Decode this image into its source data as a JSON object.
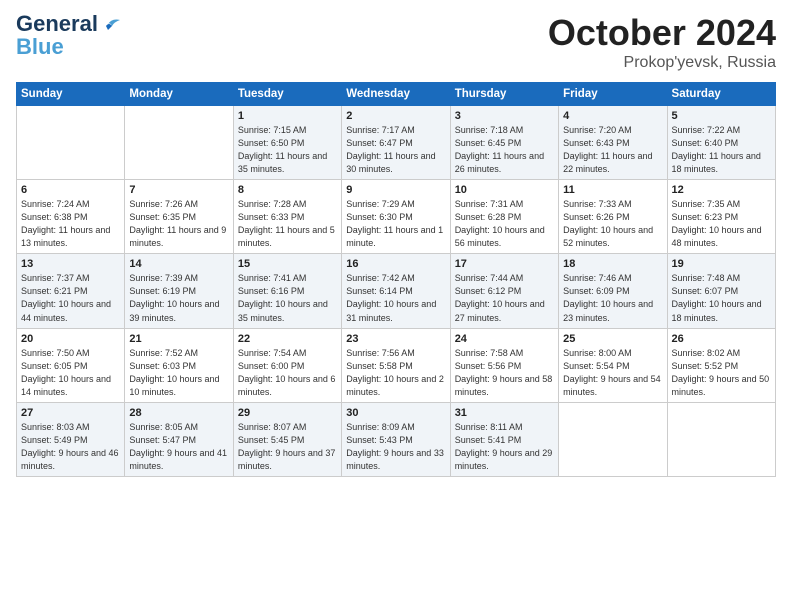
{
  "header": {
    "logo_line1": "General",
    "logo_line2": "Blue",
    "month": "October 2024",
    "location": "Prokop'yevsk, Russia"
  },
  "days_of_week": [
    "Sunday",
    "Monday",
    "Tuesday",
    "Wednesday",
    "Thursday",
    "Friday",
    "Saturday"
  ],
  "weeks": [
    [
      {
        "day": "",
        "info": ""
      },
      {
        "day": "",
        "info": ""
      },
      {
        "day": "1",
        "info": "Sunrise: 7:15 AM\nSunset: 6:50 PM\nDaylight: 11 hours and 35 minutes."
      },
      {
        "day": "2",
        "info": "Sunrise: 7:17 AM\nSunset: 6:47 PM\nDaylight: 11 hours and 30 minutes."
      },
      {
        "day": "3",
        "info": "Sunrise: 7:18 AM\nSunset: 6:45 PM\nDaylight: 11 hours and 26 minutes."
      },
      {
        "day": "4",
        "info": "Sunrise: 7:20 AM\nSunset: 6:43 PM\nDaylight: 11 hours and 22 minutes."
      },
      {
        "day": "5",
        "info": "Sunrise: 7:22 AM\nSunset: 6:40 PM\nDaylight: 11 hours and 18 minutes."
      }
    ],
    [
      {
        "day": "6",
        "info": "Sunrise: 7:24 AM\nSunset: 6:38 PM\nDaylight: 11 hours and 13 minutes."
      },
      {
        "day": "7",
        "info": "Sunrise: 7:26 AM\nSunset: 6:35 PM\nDaylight: 11 hours and 9 minutes."
      },
      {
        "day": "8",
        "info": "Sunrise: 7:28 AM\nSunset: 6:33 PM\nDaylight: 11 hours and 5 minutes."
      },
      {
        "day": "9",
        "info": "Sunrise: 7:29 AM\nSunset: 6:30 PM\nDaylight: 11 hours and 1 minute."
      },
      {
        "day": "10",
        "info": "Sunrise: 7:31 AM\nSunset: 6:28 PM\nDaylight: 10 hours and 56 minutes."
      },
      {
        "day": "11",
        "info": "Sunrise: 7:33 AM\nSunset: 6:26 PM\nDaylight: 10 hours and 52 minutes."
      },
      {
        "day": "12",
        "info": "Sunrise: 7:35 AM\nSunset: 6:23 PM\nDaylight: 10 hours and 48 minutes."
      }
    ],
    [
      {
        "day": "13",
        "info": "Sunrise: 7:37 AM\nSunset: 6:21 PM\nDaylight: 10 hours and 44 minutes."
      },
      {
        "day": "14",
        "info": "Sunrise: 7:39 AM\nSunset: 6:19 PM\nDaylight: 10 hours and 39 minutes."
      },
      {
        "day": "15",
        "info": "Sunrise: 7:41 AM\nSunset: 6:16 PM\nDaylight: 10 hours and 35 minutes."
      },
      {
        "day": "16",
        "info": "Sunrise: 7:42 AM\nSunset: 6:14 PM\nDaylight: 10 hours and 31 minutes."
      },
      {
        "day": "17",
        "info": "Sunrise: 7:44 AM\nSunset: 6:12 PM\nDaylight: 10 hours and 27 minutes."
      },
      {
        "day": "18",
        "info": "Sunrise: 7:46 AM\nSunset: 6:09 PM\nDaylight: 10 hours and 23 minutes."
      },
      {
        "day": "19",
        "info": "Sunrise: 7:48 AM\nSunset: 6:07 PM\nDaylight: 10 hours and 18 minutes."
      }
    ],
    [
      {
        "day": "20",
        "info": "Sunrise: 7:50 AM\nSunset: 6:05 PM\nDaylight: 10 hours and 14 minutes."
      },
      {
        "day": "21",
        "info": "Sunrise: 7:52 AM\nSunset: 6:03 PM\nDaylight: 10 hours and 10 minutes."
      },
      {
        "day": "22",
        "info": "Sunrise: 7:54 AM\nSunset: 6:00 PM\nDaylight: 10 hours and 6 minutes."
      },
      {
        "day": "23",
        "info": "Sunrise: 7:56 AM\nSunset: 5:58 PM\nDaylight: 10 hours and 2 minutes."
      },
      {
        "day": "24",
        "info": "Sunrise: 7:58 AM\nSunset: 5:56 PM\nDaylight: 9 hours and 58 minutes."
      },
      {
        "day": "25",
        "info": "Sunrise: 8:00 AM\nSunset: 5:54 PM\nDaylight: 9 hours and 54 minutes."
      },
      {
        "day": "26",
        "info": "Sunrise: 8:02 AM\nSunset: 5:52 PM\nDaylight: 9 hours and 50 minutes."
      }
    ],
    [
      {
        "day": "27",
        "info": "Sunrise: 8:03 AM\nSunset: 5:49 PM\nDaylight: 9 hours and 46 minutes."
      },
      {
        "day": "28",
        "info": "Sunrise: 8:05 AM\nSunset: 5:47 PM\nDaylight: 9 hours and 41 minutes."
      },
      {
        "day": "29",
        "info": "Sunrise: 8:07 AM\nSunset: 5:45 PM\nDaylight: 9 hours and 37 minutes."
      },
      {
        "day": "30",
        "info": "Sunrise: 8:09 AM\nSunset: 5:43 PM\nDaylight: 9 hours and 33 minutes."
      },
      {
        "day": "31",
        "info": "Sunrise: 8:11 AM\nSunset: 5:41 PM\nDaylight: 9 hours and 29 minutes."
      },
      {
        "day": "",
        "info": ""
      },
      {
        "day": "",
        "info": ""
      }
    ]
  ]
}
